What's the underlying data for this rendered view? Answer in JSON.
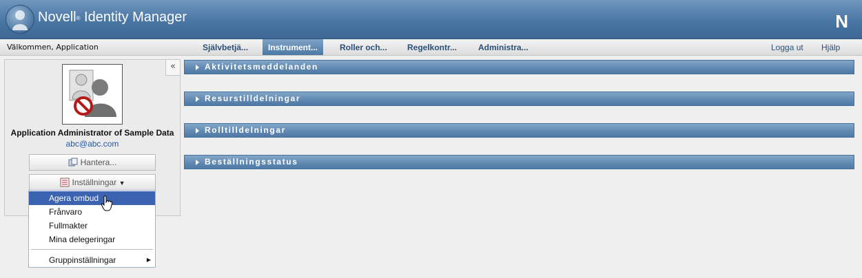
{
  "header": {
    "brand_name": "Novell",
    "brand_reg": "®",
    "brand_product": "Identity Manager",
    "corner_logo": "N"
  },
  "nav": {
    "welcome": "Välkommen, Application",
    "tabs": [
      {
        "label": "Självbetjä...",
        "active": false
      },
      {
        "label": "Instrument...",
        "active": true
      },
      {
        "label": "Roller och...",
        "active": false
      },
      {
        "label": "Regelkontr...",
        "active": false
      },
      {
        "label": "Administra...",
        "active": false
      }
    ],
    "logout": "Logga ut",
    "help": "Hjälp"
  },
  "panel": {
    "collapse_icon": "«",
    "user_name": "Application Administrator of Sample Data",
    "user_email": "abc@abc.com",
    "manage_button": "Hantera...",
    "settings_button": "Inställningar"
  },
  "menu": {
    "items": [
      "Agera ombud",
      "Frånvaro",
      "Fullmakter",
      "Mina delegeringar",
      "Gruppinställningar"
    ],
    "selected_index": 0
  },
  "sections": [
    "Aktivitetsmeddelanden",
    "Resurstilldelningar",
    "Rolltilldelningar",
    "Beställningsstatus"
  ],
  "colors": {
    "header": "#4a76a3",
    "tab_active": "#5e87b0",
    "menu_selected": "#3b63b0",
    "section_bar": "#5f88b1",
    "link": "#1f5aa8"
  }
}
